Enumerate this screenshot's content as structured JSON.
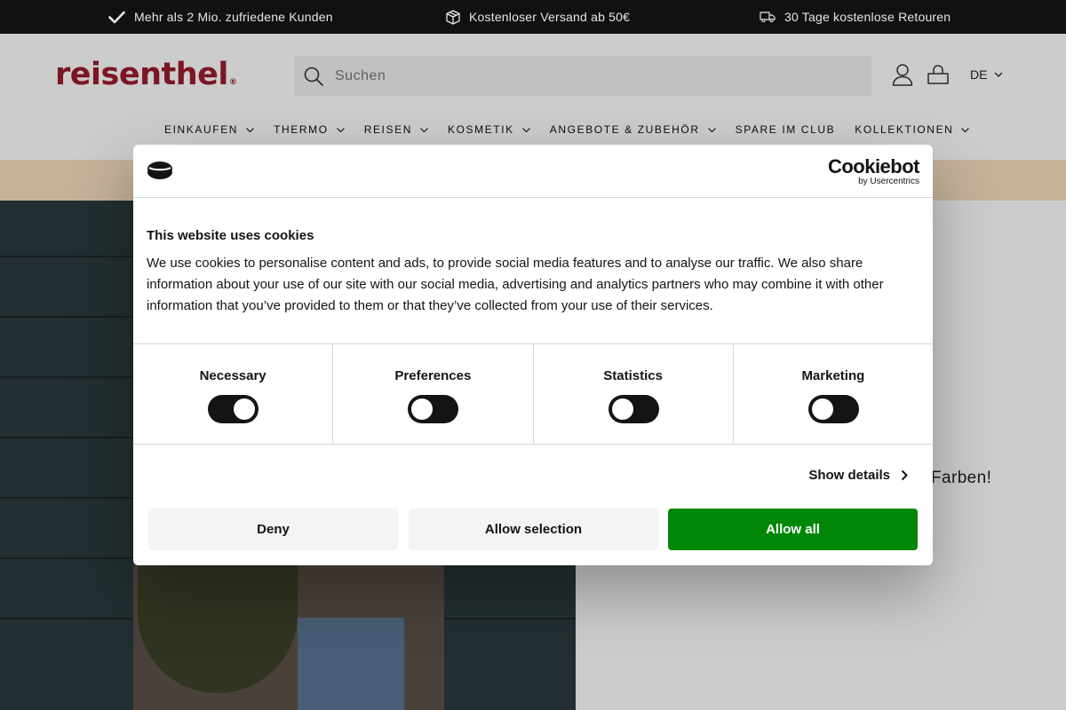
{
  "announcement": {
    "items": [
      {
        "icon": "checkmark-icon",
        "text": "Mehr als 2 Mio. zufriedene Kunden"
      },
      {
        "icon": "package-icon",
        "text": "Kostenloser Versand ab 50€"
      },
      {
        "icon": "truck-icon",
        "text": "30 Tage kostenlose Retouren"
      }
    ]
  },
  "header": {
    "logo_text": "reisenthel",
    "search_placeholder": "Suchen",
    "language": "DE",
    "nav": [
      {
        "label": "EINKAUFEN",
        "has_dropdown": true
      },
      {
        "label": "THERMO",
        "has_dropdown": true
      },
      {
        "label": "REISEN",
        "has_dropdown": true
      },
      {
        "label": "KOSMETIK",
        "has_dropdown": true
      },
      {
        "label": "ANGEBOTE & ZUBEHÖR",
        "has_dropdown": true
      },
      {
        "label": "SPARE IM CLUB",
        "has_dropdown": false
      },
      {
        "label": "KOLLEKTIONEN",
        "has_dropdown": true
      }
    ]
  },
  "hero": {
    "tagline": "Farben!"
  },
  "cookie_dialog": {
    "brand": "Cookiebot",
    "brand_sub": "by Usercentrics",
    "title": "This website uses cookies",
    "body": "We use cookies to personalise content and ads, to provide social media features and to analyse our traffic. We also share information about your use of our site with our social media, advertising and analytics partners who may combine it with other information that you’ve provided to them or that they’ve collected from your use of their services.",
    "categories": [
      {
        "label": "Necessary",
        "checked": true
      },
      {
        "label": "Preferences",
        "checked": false
      },
      {
        "label": "Statistics",
        "checked": false
      },
      {
        "label": "Marketing",
        "checked": false
      }
    ],
    "show_details": "Show details",
    "buttons": {
      "deny": "Deny",
      "allow_selection": "Allow selection",
      "allow_all": "Allow all"
    }
  },
  "colors": {
    "brand": "#9b1c2e",
    "accept": "#008707",
    "promo": "#f5dfc0"
  }
}
